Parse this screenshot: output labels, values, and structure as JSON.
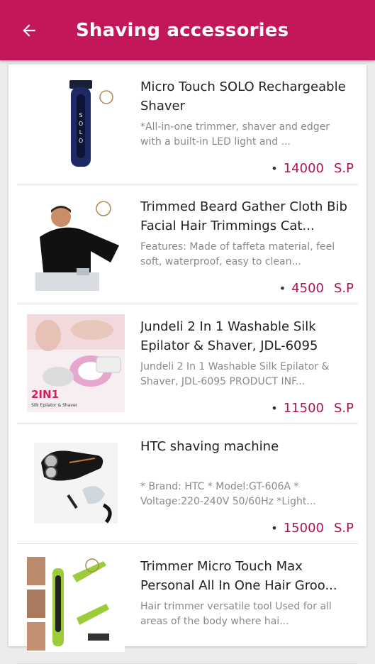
{
  "header": {
    "title": "Shaving accessories",
    "background_color": "#c2185b",
    "back_icon": "arrow-left-icon"
  },
  "products": [
    {
      "name": "Micro Touch SOLO Rechargeable Shaver",
      "description": "*All-in-one trimmer, shaver and edger with a built-in LED light and ...",
      "price": "14000",
      "currency": "S.P"
    },
    {
      "name": "Trimmed Beard Gather Cloth Bib Facial Hair Trimmings Cat...",
      "description": "Features: Made of taffeta material, feel soft, waterproof, easy to clean...",
      "price": "4500",
      "currency": "S.P"
    },
    {
      "name": "Jundeli 2 In 1 Washable Silk Epilator & Shaver, JDL-6095",
      "description": "Jundeli 2 In 1 Washable Silk Epilator & Shaver, JDL-6095 PRODUCT INF...",
      "price": "11500",
      "currency": "S.P",
      "image_text": "2IN1",
      "image_subtext": "Silk Epilator & Shaver"
    },
    {
      "name": "HTC shaving machine",
      "description": "* Brand: HTC * Model:GT-606A * Voltage:220-240V 50/60Hz *Light...",
      "price": "15000",
      "currency": "S.P"
    },
    {
      "name": "Trimmer Micro Touch Max Personal All In One Hair Groo...",
      "description": "Hair trimmer versatile tool Used for all areas of the body where hai...",
      "price": "",
      "currency": ""
    }
  ]
}
